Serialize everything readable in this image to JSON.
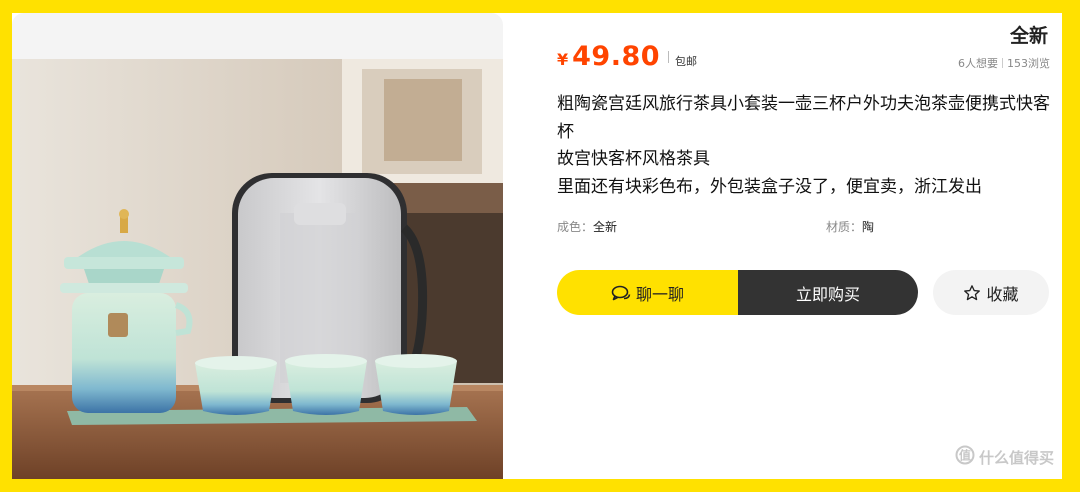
{
  "listing": {
    "condition_badge": "全新",
    "currency": "¥",
    "price": "49.80",
    "shipping": "包邮",
    "wants": "6人想要",
    "views": "153浏览",
    "description_lines": [
      "粗陶瓷宫廷风旅行茶具小套装一壶三杯户外功夫泡茶壶便携式快客杯",
      "故宫快客杯风格茶具",
      "里面还有块彩色布，外包装盒子没了，便宜卖，浙江发出"
    ],
    "attributes": [
      {
        "key": "成色：",
        "value": "全新"
      },
      {
        "key": "材质：",
        "value": "陶"
      }
    ]
  },
  "actions": {
    "chat_label": "聊一聊",
    "buy_label": "立即购买",
    "favorite_label": "收藏"
  },
  "watermark": {
    "text": "什么值得买"
  },
  "colors": {
    "background": "#ffe100",
    "price": "#ff4400",
    "buy_button": "#333333",
    "chat_button": "#ffe100"
  }
}
